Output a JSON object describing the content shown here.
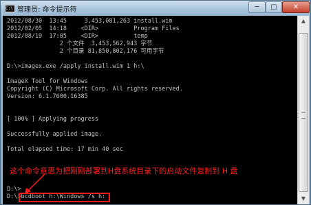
{
  "window": {
    "title": "管理员: 命令提示符",
    "app_icon_text": "C:\\",
    "minimize_glyph": "─",
    "maximize_glyph": "□",
    "close_glyph": "✕"
  },
  "console": {
    "lines": [
      "2012/08/30  13:45     3,453,081,263 install.wim",
      "2012/02/05  14:18    <DIR>          Program Files",
      "2012/08/19  17:05    <DIR>          temp",
      "               2 个文件  3,453,562,943 字节",
      "               2 个目录 81,850,802,176 可用字节",
      "",
      "D:\\>imagex.exe /apply install.wim 1 h:\\",
      "",
      "ImageX Tool for Windows",
      "Copyright (C) Microsoft Corp. All rights reserved.",
      "Version: 6.1.7600.16385",
      "",
      "",
      "[ 100% ] Applying progress",
      "",
      "Successfully applied image.",
      "",
      "Total elapsed time: 17 min 40 sec",
      "",
      "",
      "",
      "",
      "D:\\>",
      "D:\\>bcdboot h:\\Windows /s h:"
    ]
  },
  "annotation": {
    "text": "这个命令意思为把刚刚部署到H盘系统目录下的启动文件复制到 H 盘",
    "color": "#ff2020"
  },
  "scrollbar": {
    "up_glyph": "▲",
    "down_glyph": "▼"
  }
}
